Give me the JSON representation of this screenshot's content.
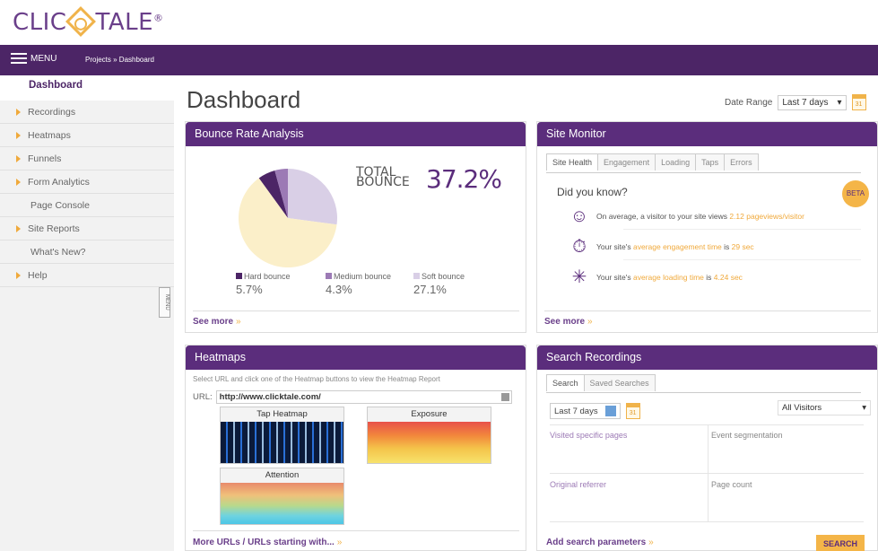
{
  "logo": {
    "prefix": "CLIC",
    "suffix": "TALE",
    "mark": "®"
  },
  "topnav": {
    "menu_label": "MENU",
    "breadcrumb": "Projects » Dashboard"
  },
  "sidebar": {
    "items": [
      {
        "label": "Dashboard",
        "active": true,
        "arrow": false
      },
      {
        "label": "Recordings",
        "arrow": true
      },
      {
        "label": "Heatmaps",
        "arrow": true
      },
      {
        "label": "Funnels",
        "arrow": true
      },
      {
        "label": "Form Analytics",
        "arrow": true
      },
      {
        "label": "Page Console",
        "arrow": false
      },
      {
        "label": "Site Reports",
        "arrow": true
      },
      {
        "label": "What's New?",
        "arrow": false
      },
      {
        "label": "Help",
        "arrow": true
      }
    ],
    "tab_label": "MENU"
  },
  "main": {
    "title": "Dashboard",
    "date_range_label": "Date Range",
    "date_range_value": "Last 7 days",
    "calendar_day": "31"
  },
  "bounce": {
    "title": "Bounce Rate Analysis",
    "total_label_1": "TOTAL",
    "total_label_2": "BOUNCE",
    "total_value": "37.2%",
    "legend": [
      {
        "label": "Hard bounce",
        "value": "5.7%",
        "color": "#4c2566"
      },
      {
        "label": "Medium bounce",
        "value": "4.3%",
        "color": "#9c7ab5"
      },
      {
        "label": "Soft bounce",
        "value": "27.1%",
        "color": "#d9cfe6"
      }
    ],
    "rest_color": "#fbefc9",
    "see_more": "See more"
  },
  "site_monitor": {
    "title": "Site Monitor",
    "tabs": [
      "Site Health",
      "Engagement",
      "Loading",
      "Taps",
      "Errors"
    ],
    "did_you_know": "Did you know?",
    "beta": "BETA",
    "stats": [
      {
        "pre": "On average, a visitor to your site views ",
        "hl": "2.12 pageviews/visitor",
        "post": ""
      },
      {
        "pre": "Your site's ",
        "hl": "average engagement time",
        "post": " is ",
        "val": "29 sec"
      },
      {
        "pre": "Your site's ",
        "hl": "average loading time",
        "post": " is ",
        "val": "4.24 sec"
      }
    ],
    "see_more": "See more"
  },
  "heatmaps": {
    "title": "Heatmaps",
    "instruction": "Select URL and click one of the Heatmap buttons to view the Heatmap Report",
    "url_label": "URL:",
    "url_value": "http://www.clicktale.com/",
    "cards": [
      "Tap Heatmap",
      "Exposure",
      "Attention"
    ],
    "more_link": "More URLs / URLs starting with..."
  },
  "search": {
    "title": "Search Recordings",
    "tabs": [
      "Search",
      "Saved Searches"
    ],
    "period": "Last 7 days",
    "visitors": "All Visitors",
    "criteria": [
      "Visited specific pages",
      "Event segmentation",
      "Original referrer",
      "Page count"
    ],
    "add_params": "Add search parameters",
    "button": "SEARCH"
  }
}
